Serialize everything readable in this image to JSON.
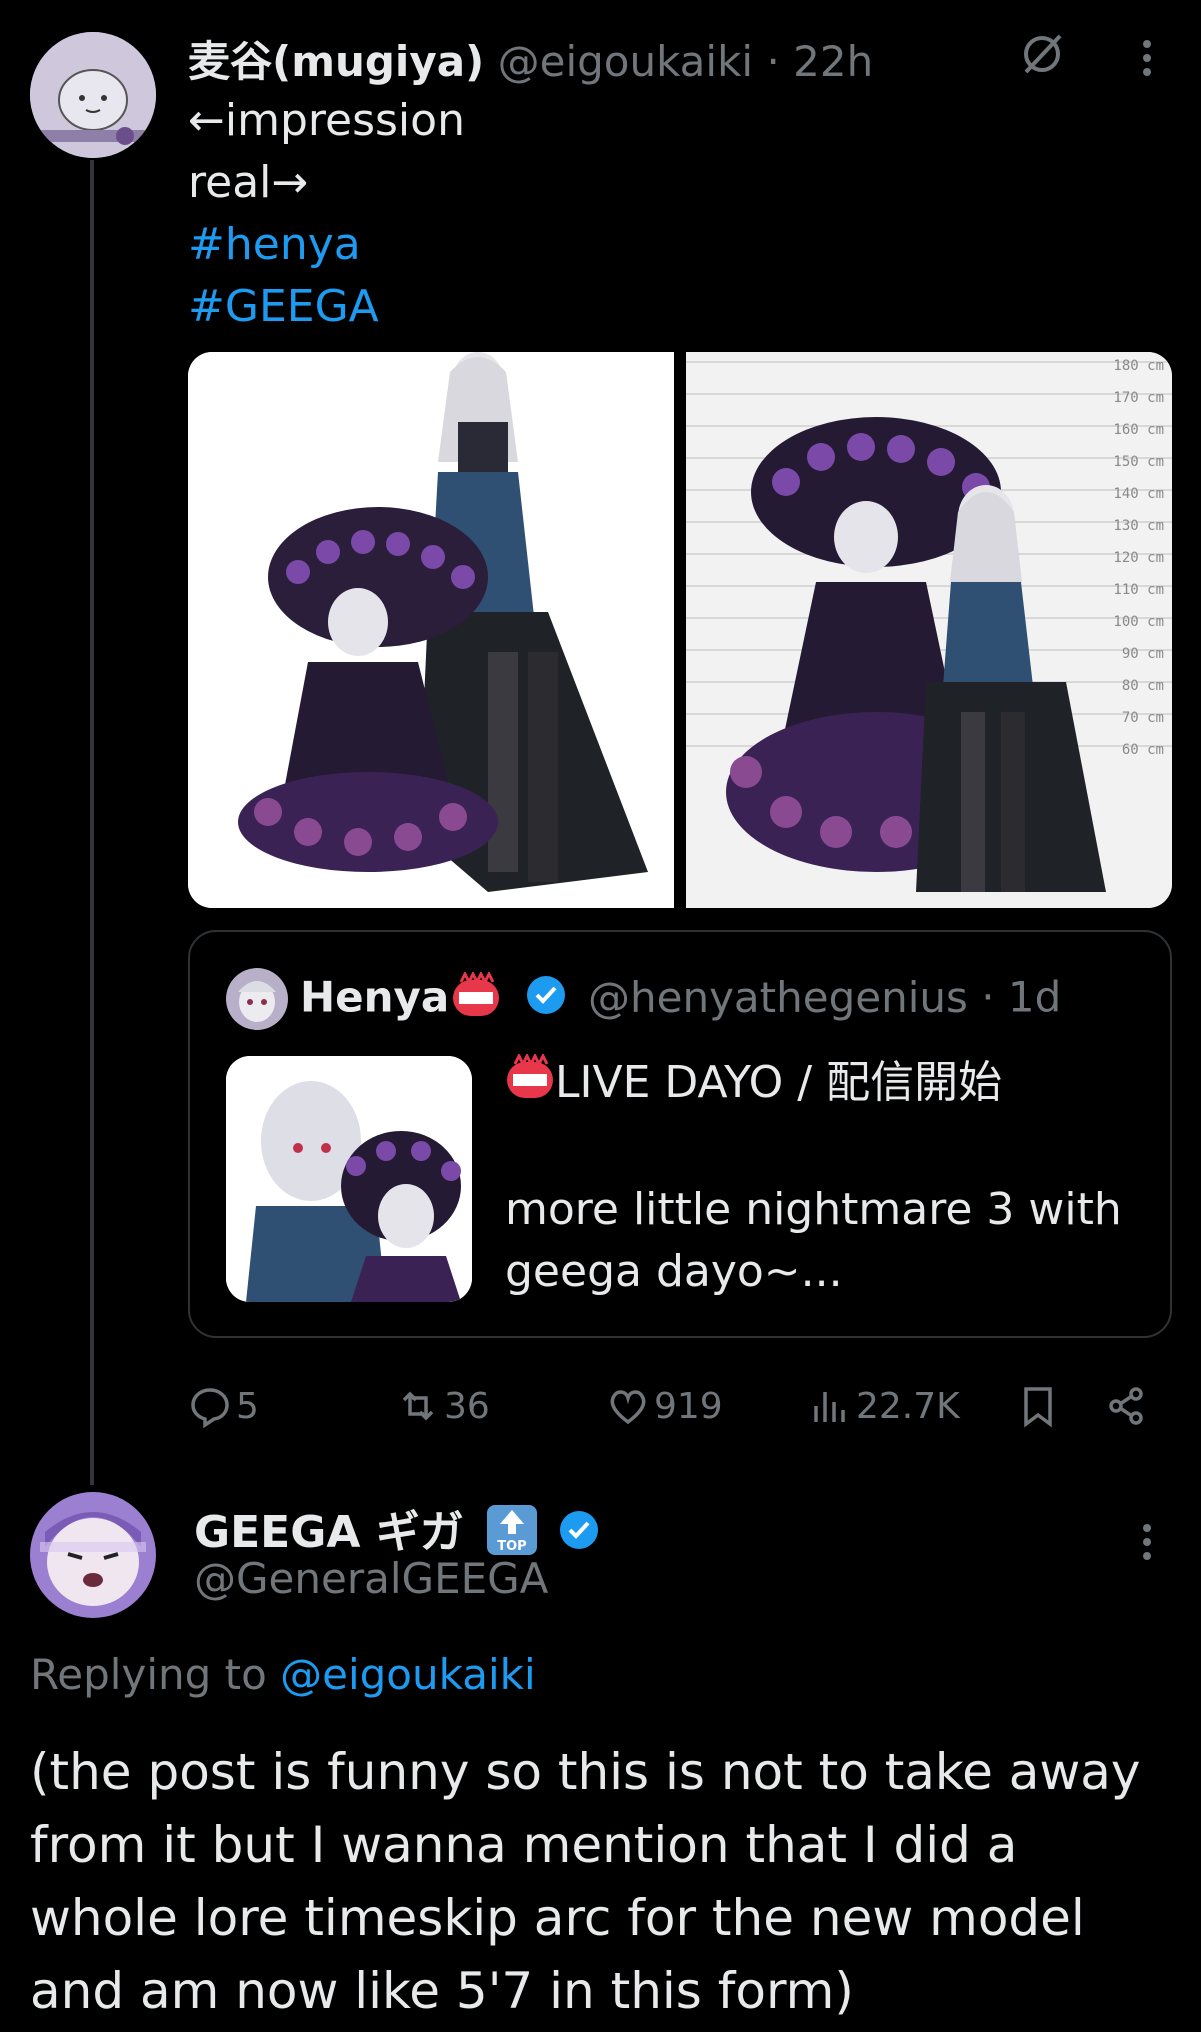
{
  "post": {
    "author_name": "麦谷(mugiya)",
    "author_handle": "@eigoukaiki",
    "time": "· 22h",
    "lines": [
      "←impression",
      "real→"
    ],
    "hashtags": [
      "#henya",
      "#GEEGA"
    ],
    "images": [
      "character-height-impression",
      "character-height-real"
    ],
    "height_scale": [
      "180 cm",
      "170 cm",
      "160 cm",
      "150 cm",
      "140 cm",
      "130 cm",
      "120 cm",
      "110 cm",
      "100 cm",
      "90 cm",
      "80 cm",
      "70 cm",
      "60 cm"
    ],
    "quote": {
      "author_name": "Henya",
      "author_handle": "@henyathegenius",
      "time": "· 1d",
      "line1": "LIVE DAYO / 配信開始",
      "line2": "more little nightmare 3 with geega dayo~..."
    },
    "actions": {
      "replies": "5",
      "reposts": "36",
      "likes": "919",
      "views": "22.7K"
    }
  },
  "reply": {
    "author_name": "GEEGA ギガ",
    "author_handle": "@GeneralGEEGA",
    "replying_prefix": "Replying to ",
    "replying_handle": "@eigoukaiki",
    "text": "(the post is funny so this is not to take away from it but I wanna mention that I did a whole lore timeskip arc for the new model and am now like 5'7 in this form)"
  },
  "colors": {
    "background": "#000000",
    "link": "#1d9bf0",
    "muted": "#71767b",
    "verified": "#1d9bf0"
  }
}
